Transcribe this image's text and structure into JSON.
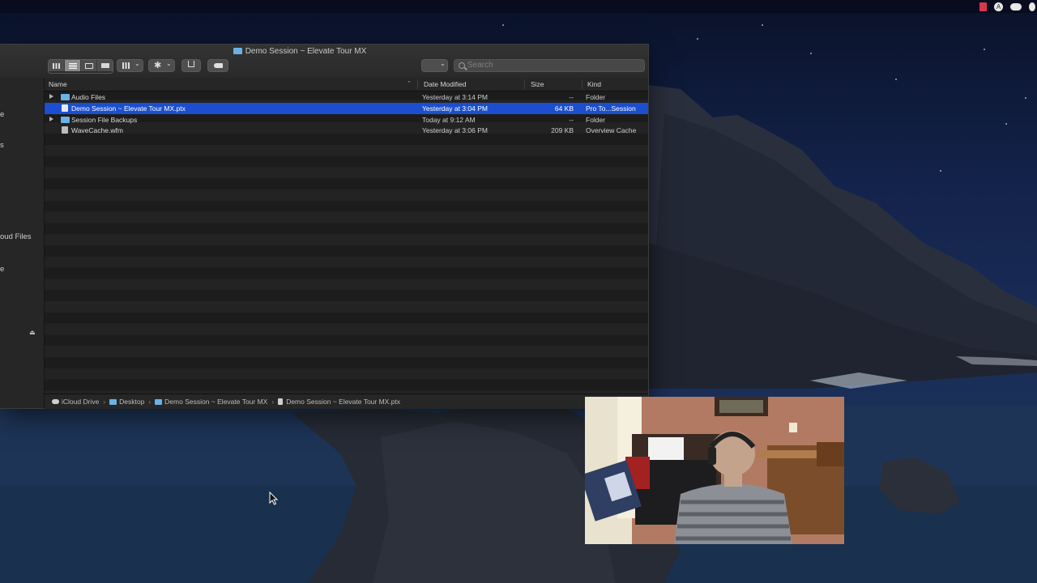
{
  "finder": {
    "title": "Demo Session ~ Elevate Tour MX",
    "search_placeholder": "Search",
    "sidebar_fragments": [
      "e",
      "s",
      "oud Files",
      "e"
    ],
    "columns": {
      "name": "Name",
      "date": "Date Modified",
      "size": "Size",
      "kind": "Kind"
    },
    "rows": [
      {
        "name": "Audio Files",
        "date": "Yesterday at 3:14 PM",
        "size": "--",
        "kind": "Folder"
      },
      {
        "name": "Demo Session ~ Elevate Tour MX.ptx",
        "date": "Yesterday at 3:04 PM",
        "size": "64 KB",
        "kind": "Pro To...Session"
      },
      {
        "name": "Session File Backups",
        "date": "Today at 9:12 AM",
        "size": "--",
        "kind": "Folder"
      },
      {
        "name": "WaveCache.wfm",
        "date": "Yesterday at 3:06 PM",
        "size": "209 KB",
        "kind": "Overview Cache"
      }
    ],
    "path": [
      "iCloud Drive",
      "Desktop",
      "Demo Session ~ Elevate Tour MX",
      "Demo Session ~ Elevate Tour MX.ptx"
    ]
  },
  "colors": {
    "selection": "#1b4fd0",
    "folder": "#6ab1e6",
    "window_bg": "#1e1e1e"
  }
}
